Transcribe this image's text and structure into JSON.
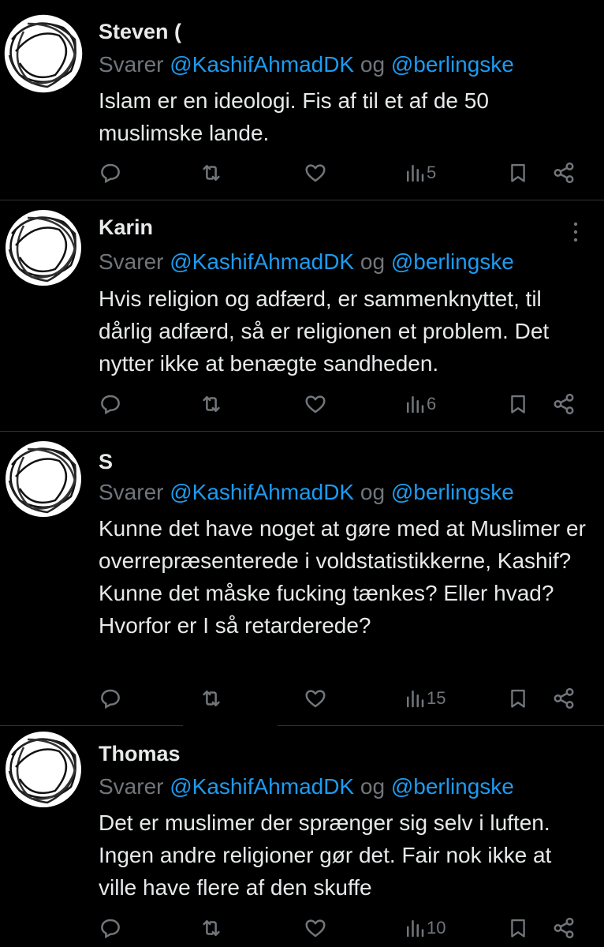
{
  "colors": {
    "background": "#000000",
    "text": "#e7e9ea",
    "secondary": "#71767b",
    "handle": "#1d9bf0",
    "divider": "#2f3336"
  },
  "replying_prefix": "Svarer",
  "joiner": "og",
  "mention_1": "@KashifAhmadDK",
  "mention_2": "@berlingske",
  "icons": [
    "reply-icon",
    "retweet-icon",
    "like-icon",
    "views-icon",
    "bookmark-icon",
    "share-icon",
    "more-icon"
  ],
  "tweets": [
    {
      "name": "Steven (",
      "text": "Islam er en ideologi. Fis af til et af de 50 muslimske lande.",
      "views": "5"
    },
    {
      "name": "Karin",
      "text": "Hvis religion og adfærd, er sammenknyttet, til dårlig adfærd, så er religionen et problem. Det nytter ikke at benægte sandheden.",
      "views": "6"
    },
    {
      "name": "S",
      "text": "Kunne det have noget at gøre med at Muslimer er overrepræsenterede i voldstatistikkerne, Kashif? Kunne det måske fucking tænkes? Eller hvad? Hvorfor er I så retarderede?",
      "views": "15"
    },
    {
      "name": "Thomas",
      "text": "Det er muslimer der sprænger sig selv i luften. Ingen andre religioner gør det. Fair nok ikke at ville have flere af den skuffe",
      "views": "10"
    }
  ]
}
